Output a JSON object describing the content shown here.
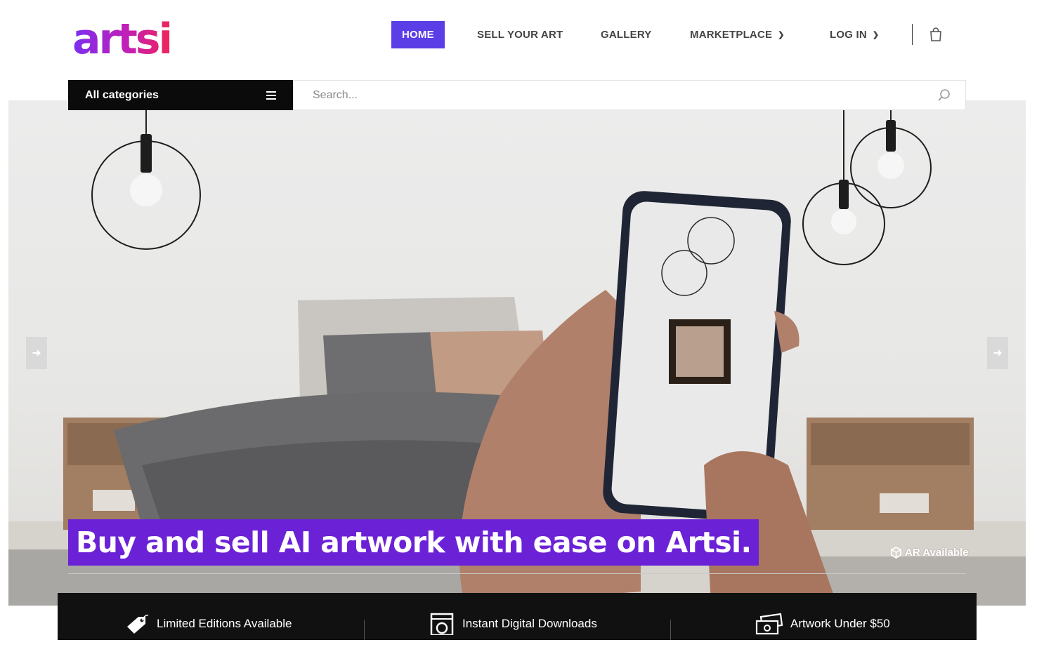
{
  "brand": {
    "logo_text": "artsi"
  },
  "nav": {
    "items": [
      {
        "label": "HOME",
        "active": true
      },
      {
        "label": "SELL YOUR ART"
      },
      {
        "label": "GALLERY"
      },
      {
        "label": "MARKETPLACE",
        "dropdown": true
      },
      {
        "label": "LOG IN",
        "dropdown": true
      }
    ],
    "cart_icon": "shopping-bag-icon"
  },
  "search": {
    "category_label": "All categories",
    "placeholder": "Search..."
  },
  "hero": {
    "headline": "Buy and sell AI artwork with ease on Artsi.",
    "ar_badge": "AR Available",
    "prev_icon": "arrow-left-icon",
    "next_icon": "arrow-right-icon"
  },
  "features": [
    {
      "label": "Limited Editions Available",
      "icon": "tag-icon"
    },
    {
      "label": "Instant Digital Downloads",
      "icon": "download-icon"
    },
    {
      "label": "Artwork Under $50",
      "icon": "money-icon"
    }
  ],
  "colors": {
    "accent": "#5b3ee6",
    "headline_bg": "#6b22d6",
    "dark": "#0b0b0b",
    "logo_gradient": [
      "#7a2ff0",
      "#d21fa6",
      "#f0245a"
    ]
  }
}
